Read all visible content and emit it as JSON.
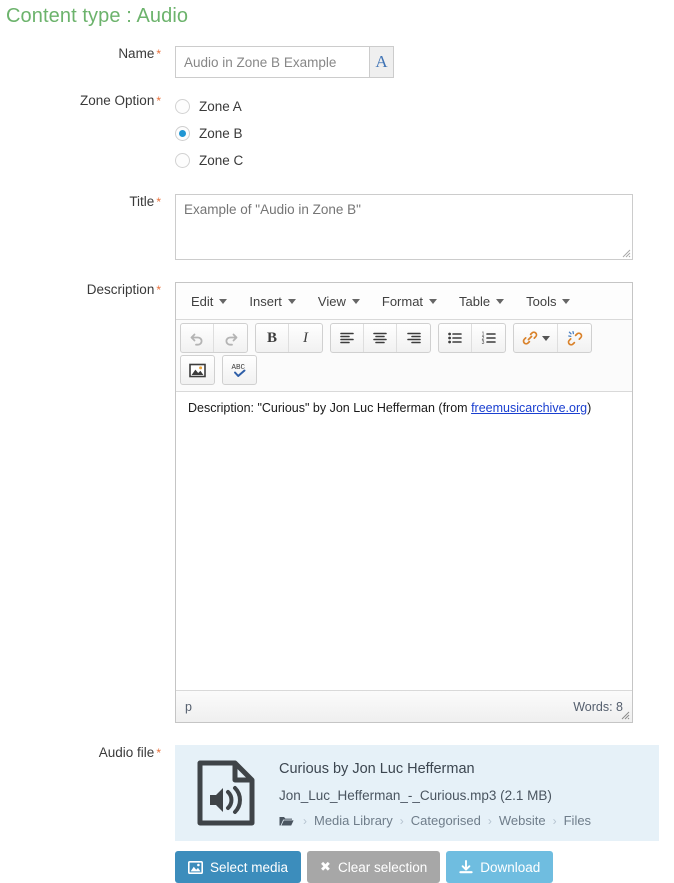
{
  "page": {
    "title": "Content type : Audio",
    "title_color": "#6cb36c"
  },
  "fields": {
    "name": {
      "label": "Name",
      "required_mark": "*",
      "value": "",
      "placeholder": "Audio in Zone B Example",
      "addon_label": "A"
    },
    "zone": {
      "label": "Zone Option",
      "required_mark": "*",
      "options": [
        {
          "label": "Zone A",
          "selected": false
        },
        {
          "label": "Zone B",
          "selected": true
        },
        {
          "label": "Zone C",
          "selected": false
        }
      ]
    },
    "title": {
      "label": "Title",
      "required_mark": "*",
      "value": "",
      "placeholder": "Example of \"Audio in Zone B\""
    },
    "description": {
      "label": "Description",
      "required_mark": "*"
    },
    "audio_file": {
      "label": "Audio file",
      "required_mark": "*"
    }
  },
  "editor": {
    "menubar": [
      {
        "label": "Edit",
        "icon": "chevron-down-icon"
      },
      {
        "label": "Insert",
        "icon": "chevron-down-icon"
      },
      {
        "label": "View",
        "icon": "chevron-down-icon"
      },
      {
        "label": "Format",
        "icon": "chevron-down-icon"
      },
      {
        "label": "Table",
        "icon": "chevron-down-icon"
      },
      {
        "label": "Tools",
        "icon": "chevron-down-icon"
      }
    ],
    "toolbar_row1": [
      {
        "icon": "undo-icon",
        "label": "Undo",
        "disabled": true
      },
      {
        "icon": "redo-icon",
        "label": "Redo",
        "disabled": true
      },
      {
        "icon": "bold-icon",
        "label": "B",
        "disabled": false
      },
      {
        "icon": "italic-icon",
        "label": "I",
        "disabled": false
      },
      {
        "icon": "align-left-icon",
        "label": "Align left",
        "disabled": false
      },
      {
        "icon": "align-center-icon",
        "label": "Align center",
        "disabled": false
      },
      {
        "icon": "align-right-icon",
        "label": "Align right",
        "disabled": false
      },
      {
        "icon": "bullet-list-icon",
        "label": "Bullet list",
        "disabled": false
      },
      {
        "icon": "numbered-list-icon",
        "label": "Numbered list",
        "disabled": false
      },
      {
        "icon": "link-icon",
        "label": "Insert link",
        "disabled": false
      },
      {
        "icon": "unlink-icon",
        "label": "Remove link",
        "disabled": false
      }
    ],
    "toolbar_row2": [
      {
        "icon": "image-icon",
        "label": "Insert image",
        "disabled": false
      },
      {
        "icon": "spellcheck-icon",
        "label": "Spellcheck",
        "disabled": false
      }
    ],
    "content": {
      "prefix": "Description: \"Curious\" by Jon Luc Hefferman (from ",
      "link_text": "freemusicarchive.org",
      "suffix": ")"
    },
    "status": {
      "path": "p",
      "words": "Words: 8"
    }
  },
  "audio": {
    "icon": "audio-file-icon",
    "title": "Curious by Jon Luc Hefferman",
    "filename": "Jon_Luc_Hefferman_-_Curious.mp3 (2.1 MB)",
    "breadcrumb": {
      "folder_icon": "folder-icon",
      "items": [
        "Media Library",
        "Categorised",
        "Website",
        "Files"
      ],
      "separator": "›"
    },
    "buttons": [
      {
        "label": "Select media",
        "icon": "image-icon",
        "style": "primary",
        "color": "#3c8dbc"
      },
      {
        "label": "Clear selection",
        "icon": "close-icon",
        "style": "default",
        "color": "#a7a7a7"
      },
      {
        "label": "Download",
        "icon": "download-icon",
        "style": "info",
        "color": "#6fbde0"
      }
    ]
  }
}
